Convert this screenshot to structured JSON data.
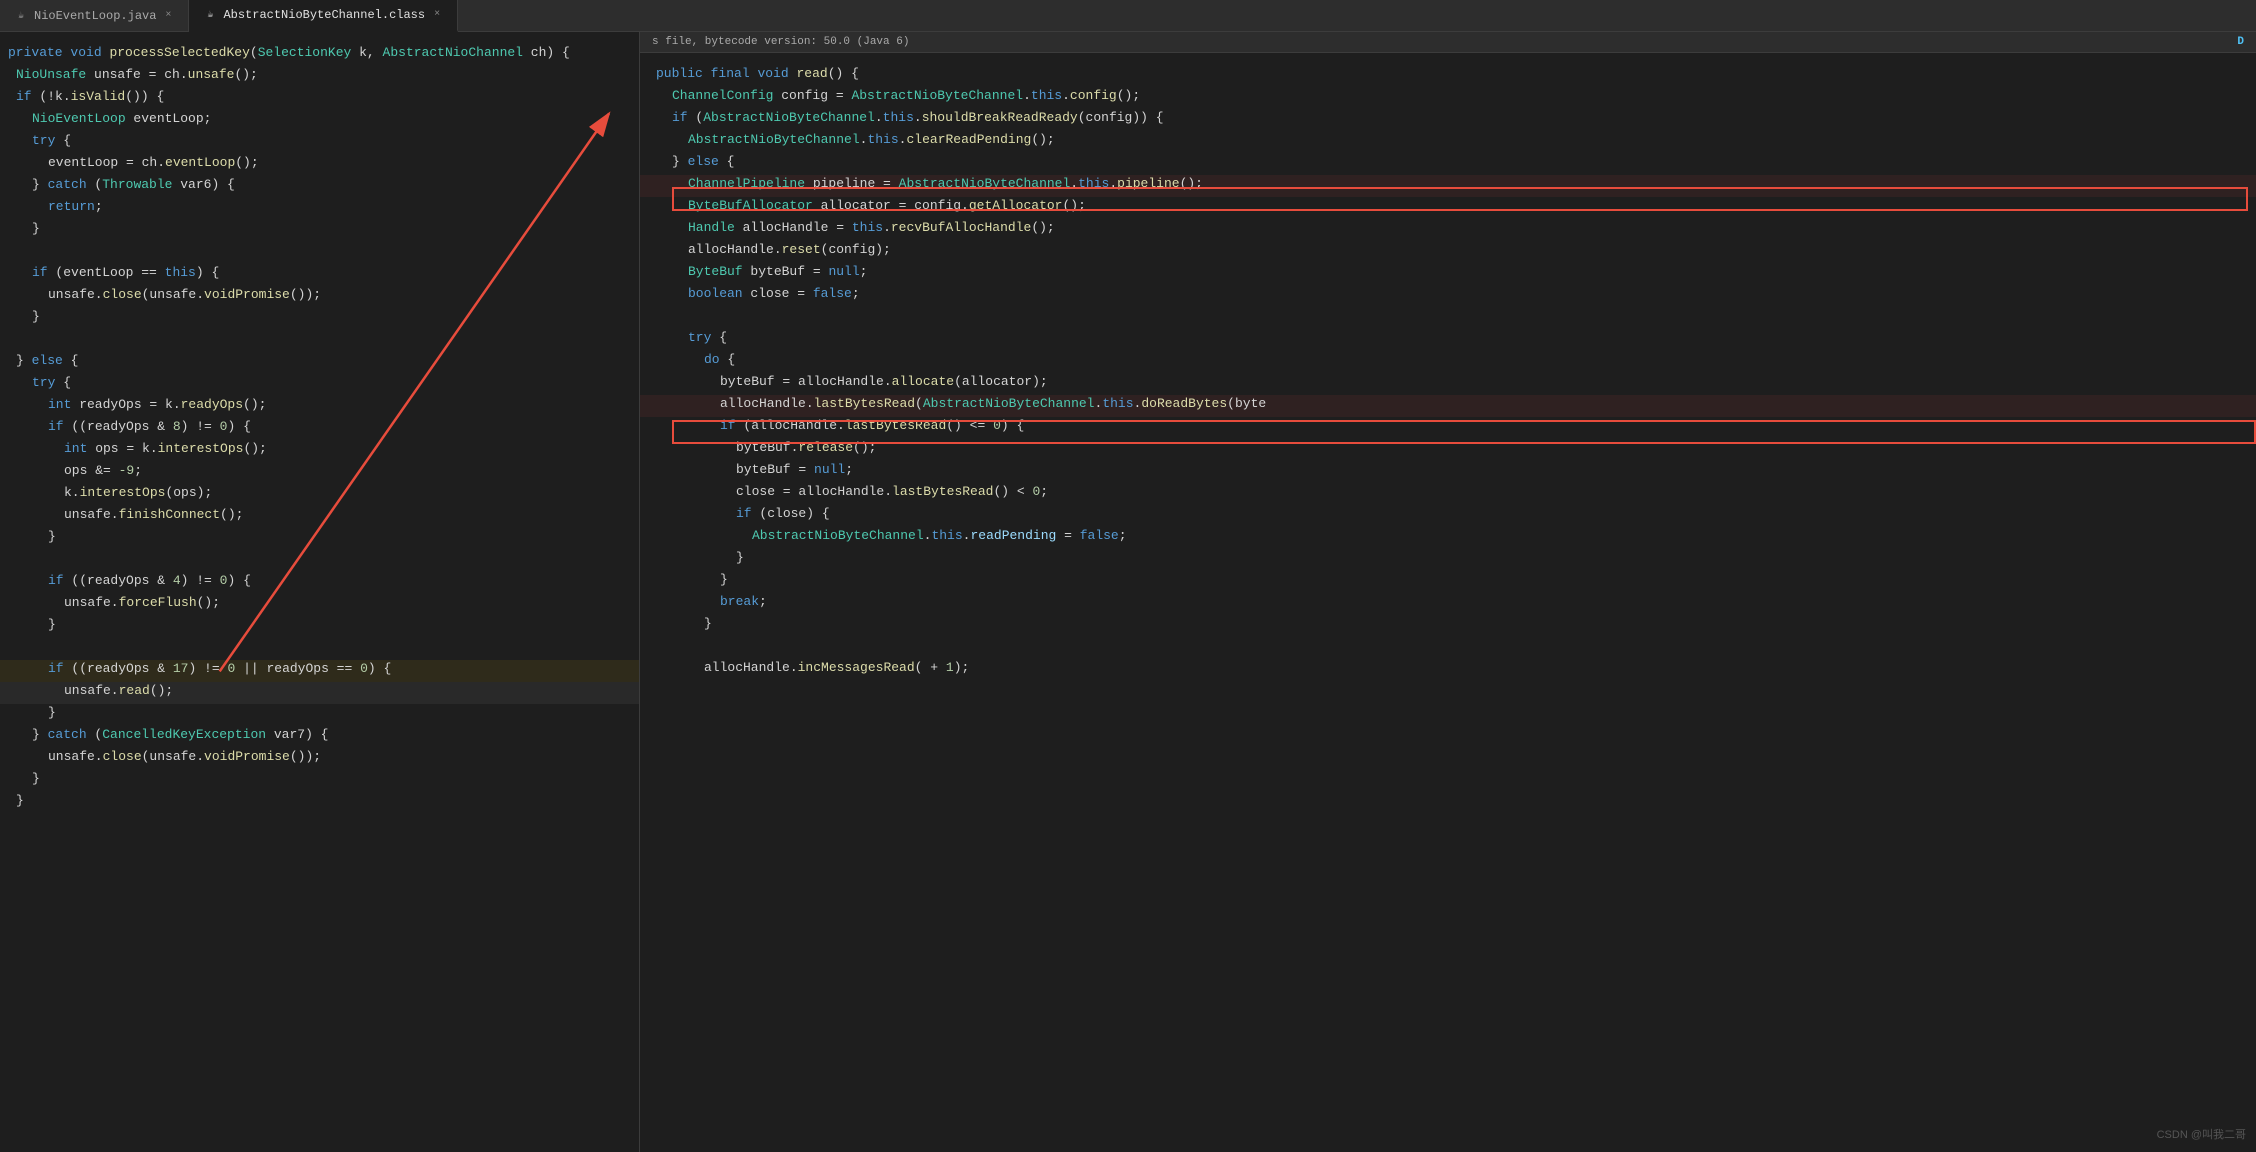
{
  "tabs": {
    "left_tabs": [
      {
        "label": "NioEventLoop.java",
        "active": false,
        "closable": true
      },
      {
        "label": "AbstractNioByteChannel.class",
        "active": true,
        "closable": true
      }
    ],
    "right_info": "s file, bytecode version: 50.0 (Java 6)",
    "right_badge": "D"
  },
  "left_code": {
    "lines": [
      {
        "num": "",
        "text": "private void processSelectedKey(SelectionKey k, AbstractNioChannel ch) {"
      },
      {
        "num": "",
        "text": "    NioUnsafe unsafe = ch.unsafe();"
      },
      {
        "num": "",
        "text": "    if (!k.isValid()) {"
      },
      {
        "num": "",
        "text": "        NioEventLoop eventLoop;"
      },
      {
        "num": "",
        "text": "        try {"
      },
      {
        "num": "",
        "text": "            eventLoop = ch.eventLoop();"
      },
      {
        "num": "",
        "text": "        } catch (Throwable var6) {"
      },
      {
        "num": "",
        "text": "            return;"
      },
      {
        "num": "",
        "text": "        }"
      },
      {
        "num": "",
        "text": ""
      },
      {
        "num": "",
        "text": "        if (eventLoop == this) {"
      },
      {
        "num": "",
        "text": "            unsafe.close(unsafe.voidPromise());"
      },
      {
        "num": "",
        "text": "        }"
      },
      {
        "num": "",
        "text": ""
      },
      {
        "num": "",
        "text": "    } else {"
      },
      {
        "num": "",
        "text": "        try {"
      },
      {
        "num": "",
        "text": "            int readyOps = k.readyOps();"
      },
      {
        "num": "",
        "text": "            if ((readyOps & 8) != 0) {"
      },
      {
        "num": "",
        "text": "                int ops = k.interestOps();"
      },
      {
        "num": "",
        "text": "                ops &= -9;"
      },
      {
        "num": "",
        "text": "                k.interestOps(ops);"
      },
      {
        "num": "",
        "text": "                unsafe.finishConnect();"
      },
      {
        "num": "",
        "text": "            }"
      },
      {
        "num": "",
        "text": ""
      },
      {
        "num": "",
        "text": "            if ((readyOps & 4) != 0) {"
      },
      {
        "num": "",
        "text": "                unsafe.forceFlush();"
      },
      {
        "num": "",
        "text": "            }"
      },
      {
        "num": "",
        "text": ""
      },
      {
        "num": "",
        "text": "            if ((readyOps & 17) != 0 || readyOps == 0) {"
      },
      {
        "num": "",
        "text": "                unsafe.read();"
      },
      {
        "num": "",
        "text": "            }"
      },
      {
        "num": "",
        "text": "        } catch (CancelledKeyException var7) {"
      },
      {
        "num": "",
        "text": "            unsafe.close(unsafe.voidPromise());"
      },
      {
        "num": "",
        "text": "        }"
      },
      {
        "num": "",
        "text": "    }"
      }
    ]
  },
  "right_code": {
    "lines": [
      {
        "text": "    public final void read() {"
      },
      {
        "text": "        ChannelConfig config = AbstractNioByteChannel.this.config();"
      },
      {
        "text": "        if (AbstractNioByteChannel.this.shouldBreakReadReady(config)) {"
      },
      {
        "text": "            AbstractNioByteChannel.this.clearReadPending();"
      },
      {
        "text": "        } else {"
      },
      {
        "text": "            ChannelPipeline pipeline = AbstractNioByteChannel.this.pipeline();",
        "boxed": true
      },
      {
        "text": "            ByteBufAllocator allocator = config.getAllocator();"
      },
      {
        "text": "            Handle allocHandle = this.recvBufAllocHandle();"
      },
      {
        "text": "            allocHandle.reset(config);"
      },
      {
        "text": "            ByteBuf byteBuf = null;"
      },
      {
        "text": "            boolean close = false;"
      },
      {
        "text": ""
      },
      {
        "text": "            try {"
      },
      {
        "text": "                do {"
      },
      {
        "text": "                    byteBuf = allocHandle.allocate(allocator);"
      },
      {
        "text": "                    allocHandle.lastBytesRead(AbstractNioByteChannel.this.doReadBytes(byte",
        "boxed": true
      },
      {
        "text": "                    if (allocHandle.lastBytesRead() <= 0) {"
      },
      {
        "text": "                        byteBuf.release();"
      },
      {
        "text": "                        byteBuf = null;"
      },
      {
        "text": "                        close = allocHandle.lastBytesRead() < 0;"
      },
      {
        "text": "                        if (close) {"
      },
      {
        "text": "                            AbstractNioByteChannel.this.readPending = false;"
      },
      {
        "text": "                        }"
      },
      {
        "text": "                    }"
      },
      {
        "text": "                    break;"
      },
      {
        "text": "                }"
      },
      {
        "text": ""
      },
      {
        "text": "                allocHandle.incMessagesRead( + 1);"
      }
    ]
  },
  "watermark": "CSDN @叫我二哥"
}
